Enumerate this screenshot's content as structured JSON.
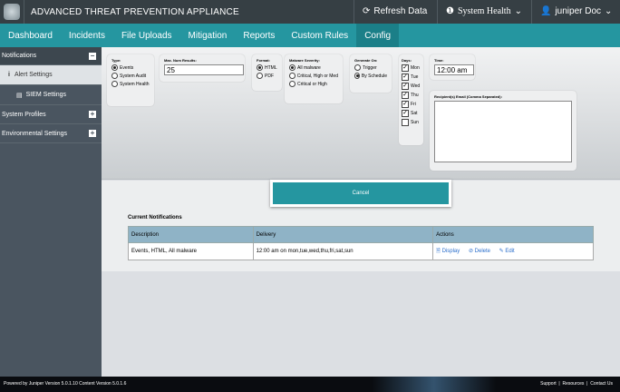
{
  "header": {
    "title": "ADVANCED THREAT PREVENTION APPLIANCE",
    "refresh": "Refresh Data",
    "health": "System Health",
    "user": "juniper Doc"
  },
  "nav": [
    "Dashboard",
    "Incidents",
    "File Uploads",
    "Mitigation",
    "Reports",
    "Custom Rules",
    "Config"
  ],
  "sidebar": {
    "notifications": "Notifications",
    "alert": "Alert Settings",
    "siem": "SIEM Settings",
    "profiles": "System Profiles",
    "env": "Environmental Settings"
  },
  "form": {
    "type_label": "Type:",
    "types": [
      "Events",
      "System Audit",
      "System Health"
    ],
    "max_label": "Max. Num Results:",
    "max_value": "25",
    "format_label": "Format:",
    "formats": [
      "HTML",
      "PDF"
    ],
    "sev_label": "Malware Severity:",
    "sevs": [
      "All malware",
      "Critical, High or Med",
      "Critical or High"
    ],
    "gen_label": "Generate On:",
    "gens": [
      "Trigger",
      "By Schedule"
    ],
    "days_label": "Days:",
    "days": [
      "Mon",
      "Tue",
      "Wed",
      "Thu",
      "Fri",
      "Sat",
      "Sun"
    ],
    "time_label": "Time:",
    "time_value": "12:00 am",
    "recip_label": "Recipient(s) Email (Comma Separated):"
  },
  "cancel": "Cancel",
  "notifications": {
    "title": "Current Notifications",
    "headers": [
      "Description",
      "Delivery",
      "Actions"
    ],
    "rows": [
      {
        "description": "Events, HTML, All malware",
        "delivery": "12:00 am on mon,tue,wed,thu,fri,sat,sun"
      }
    ],
    "actions": [
      "Display",
      "Delete",
      "Edit"
    ]
  },
  "footer": {
    "version": "Powered by Juniper Version 5.0.1.10 Content Version 5.0.1.6",
    "links": [
      "Support",
      "Resources",
      "Contact Us"
    ]
  }
}
